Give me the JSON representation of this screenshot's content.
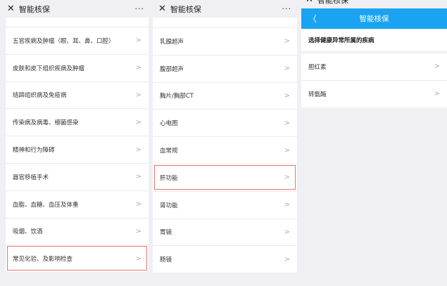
{
  "app_title": "智能核保",
  "panel1": {
    "items": [
      "五官疾病及肿瘤（眼、耳、鼻、口腔）",
      "皮肤和皮下组织疾病及肿瘤",
      "结蹄组织病及免疫病",
      "传染病及病毒、细菌感染",
      "精神和行为障碍",
      "器官移植手术",
      "血脂、血糖、血压及体重",
      "吸烟、饮酒",
      "常见化验、及影响检查"
    ],
    "highlighted": 8
  },
  "panel2": {
    "items": [
      "乳腺超声",
      "腹部超声",
      "胸片/胸部CT",
      "心电图",
      "血常规",
      "肝功能",
      "肾功能",
      "胃镜",
      "肠镜"
    ],
    "highlighted": 5
  },
  "panel3": {
    "nav_title": "智能核保",
    "subtitle": "选择健康异常所属的疾病",
    "items": [
      "胆红素",
      "转氨酶"
    ]
  },
  "colors": {
    "accent": "#19a3f1",
    "highlight": "#e8756c"
  }
}
